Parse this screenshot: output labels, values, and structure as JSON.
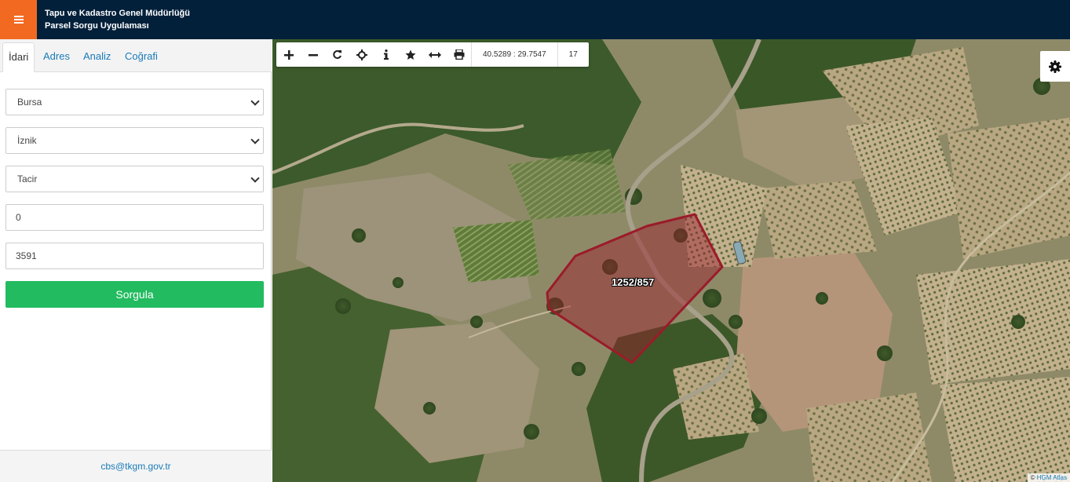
{
  "header": {
    "title_line1": "Tapu ve Kadastro Genel Müdürlüğü",
    "title_line2": "Parsel Sorgu Uygulaması",
    "menu_icon": "hamburger-icon"
  },
  "sidebar": {
    "tabs": [
      {
        "label": "İdari",
        "active": true
      },
      {
        "label": "Adres",
        "active": false
      },
      {
        "label": "Analiz",
        "active": false
      },
      {
        "label": "Coğrafi",
        "active": false
      }
    ],
    "fields": {
      "province": "Bursa",
      "district": "İznik",
      "neighborhood": "Tacir",
      "block": "0",
      "parcel": "3591"
    },
    "query_button": "Sorgula",
    "footer_email": "cbs@tkgm.gov.tr"
  },
  "map": {
    "toolbar": {
      "icons": [
        "zoom-in-icon",
        "zoom-out-icon",
        "refresh-icon",
        "locate-icon",
        "info-icon",
        "star-icon",
        "measure-icon",
        "print-icon"
      ],
      "coordinates": "40.5289 : 29.7547",
      "zoom_level": "17"
    },
    "parcel_label": "1252/857",
    "attribution_prefix": "©",
    "attribution_link": "HGM Atlas",
    "parcel_color": "#9b1b2a"
  }
}
